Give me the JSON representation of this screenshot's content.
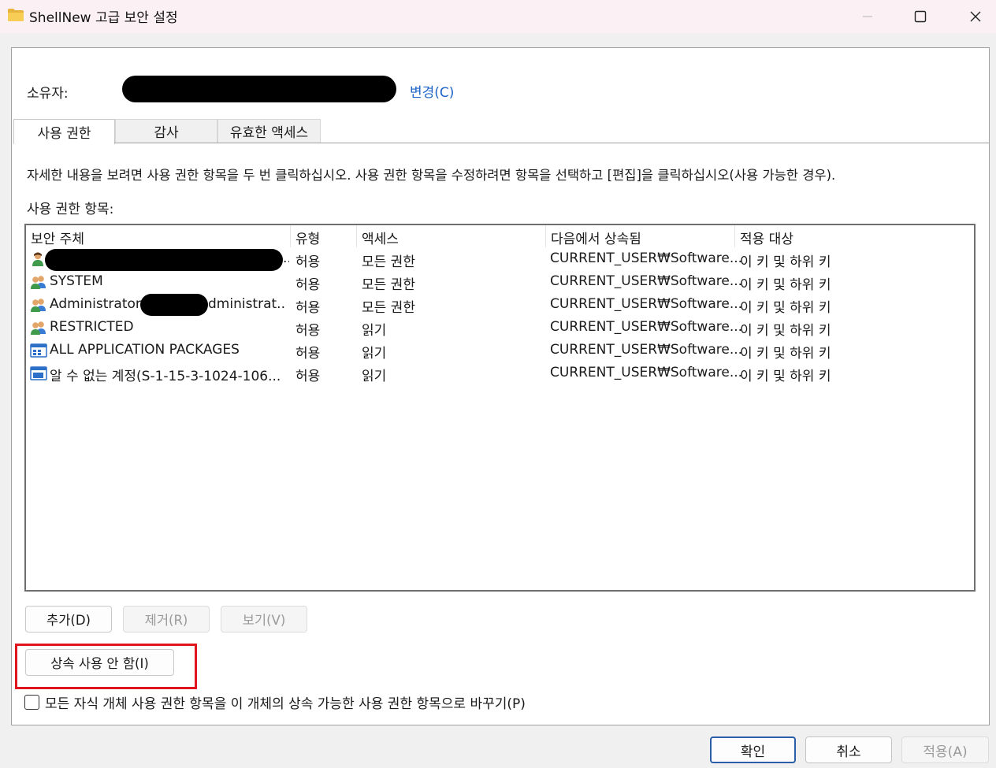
{
  "window": {
    "title": "ShellNew 고급 보안 설정",
    "folder_icon": "folder-icon",
    "minimize_icon": "minimize-icon",
    "maximize_icon": "maximize-icon",
    "close_icon": "close-icon"
  },
  "owner": {
    "label": "소유자:",
    "change_link": "변경(C)"
  },
  "tabs": [
    {
      "label": "사용 권한",
      "active": true
    },
    {
      "label": "감사",
      "active": false
    },
    {
      "label": "유효한 액세스",
      "active": false
    }
  ],
  "instructions": "자세한 내용을 보려면 사용 권한 항목을 두 번 클릭하십시오. 사용 권한 항목을 수정하려면 항목을 선택하고 [편집]을 클릭하십시오(사용 가능한 경우).",
  "entries_label": "사용 권한 항목:",
  "columns": [
    "보안 주체",
    "유형",
    "액세스",
    "다음에서 상속됨",
    "적용 대상"
  ],
  "entries": [
    {
      "icon": "user-icon",
      "principal": "",
      "principal_suffix": "..",
      "type": "허용",
      "access": "모든 권한",
      "inherited_from": "CURRENT_USER₩Software...",
      "applies_to": "이 키 및 하위 키"
    },
    {
      "icon": "group-icon",
      "principal": "SYSTEM",
      "principal_suffix": "",
      "type": "허용",
      "access": "모든 권한",
      "inherited_from": "CURRENT_USER₩Software...",
      "applies_to": "이 키 및 하위 키"
    },
    {
      "icon": "group-icon",
      "principal": "Administrators",
      "principal_suffix": "dministrat...",
      "type": "허용",
      "access": "모든 권한",
      "inherited_from": "CURRENT_USER₩Software...",
      "applies_to": "이 키 및 하위 키"
    },
    {
      "icon": "group-icon",
      "principal": "RESTRICTED",
      "principal_suffix": "",
      "type": "허용",
      "access": "읽기",
      "inherited_from": "CURRENT_USER₩Software...",
      "applies_to": "이 키 및 하위 키"
    },
    {
      "icon": "app-packages-icon",
      "principal": "ALL APPLICATION PACKAGES",
      "principal_suffix": "",
      "type": "허용",
      "access": "읽기",
      "inherited_from": "CURRENT_USER₩Software...",
      "applies_to": "이 키 및 하위 키"
    },
    {
      "icon": "app-packages-icon",
      "principal": "알 수 없는 계정(S-1-15-3-1024-106...",
      "principal_suffix": "",
      "type": "허용",
      "access": "읽기",
      "inherited_from": "CURRENT_USER₩Software...",
      "applies_to": "이 키 및 하위 키"
    }
  ],
  "buttons": {
    "add": "추가(D)",
    "remove": "제거(R)",
    "view": "보기(V)",
    "disable_inheritance": "상속 사용 안 함(I)"
  },
  "replace_checkbox": {
    "label": "모든 자식 개체 사용 권한 항목을 이 개체의 상속 가능한 사용 권한 항목으로 바꾸기(P)",
    "checked": false
  },
  "footer": {
    "ok": "확인",
    "cancel": "취소",
    "apply": "적용(A)"
  },
  "colors": {
    "link": "#1d63c8",
    "highlight": "#e0161e",
    "primary_border": "#2a5ea8"
  }
}
